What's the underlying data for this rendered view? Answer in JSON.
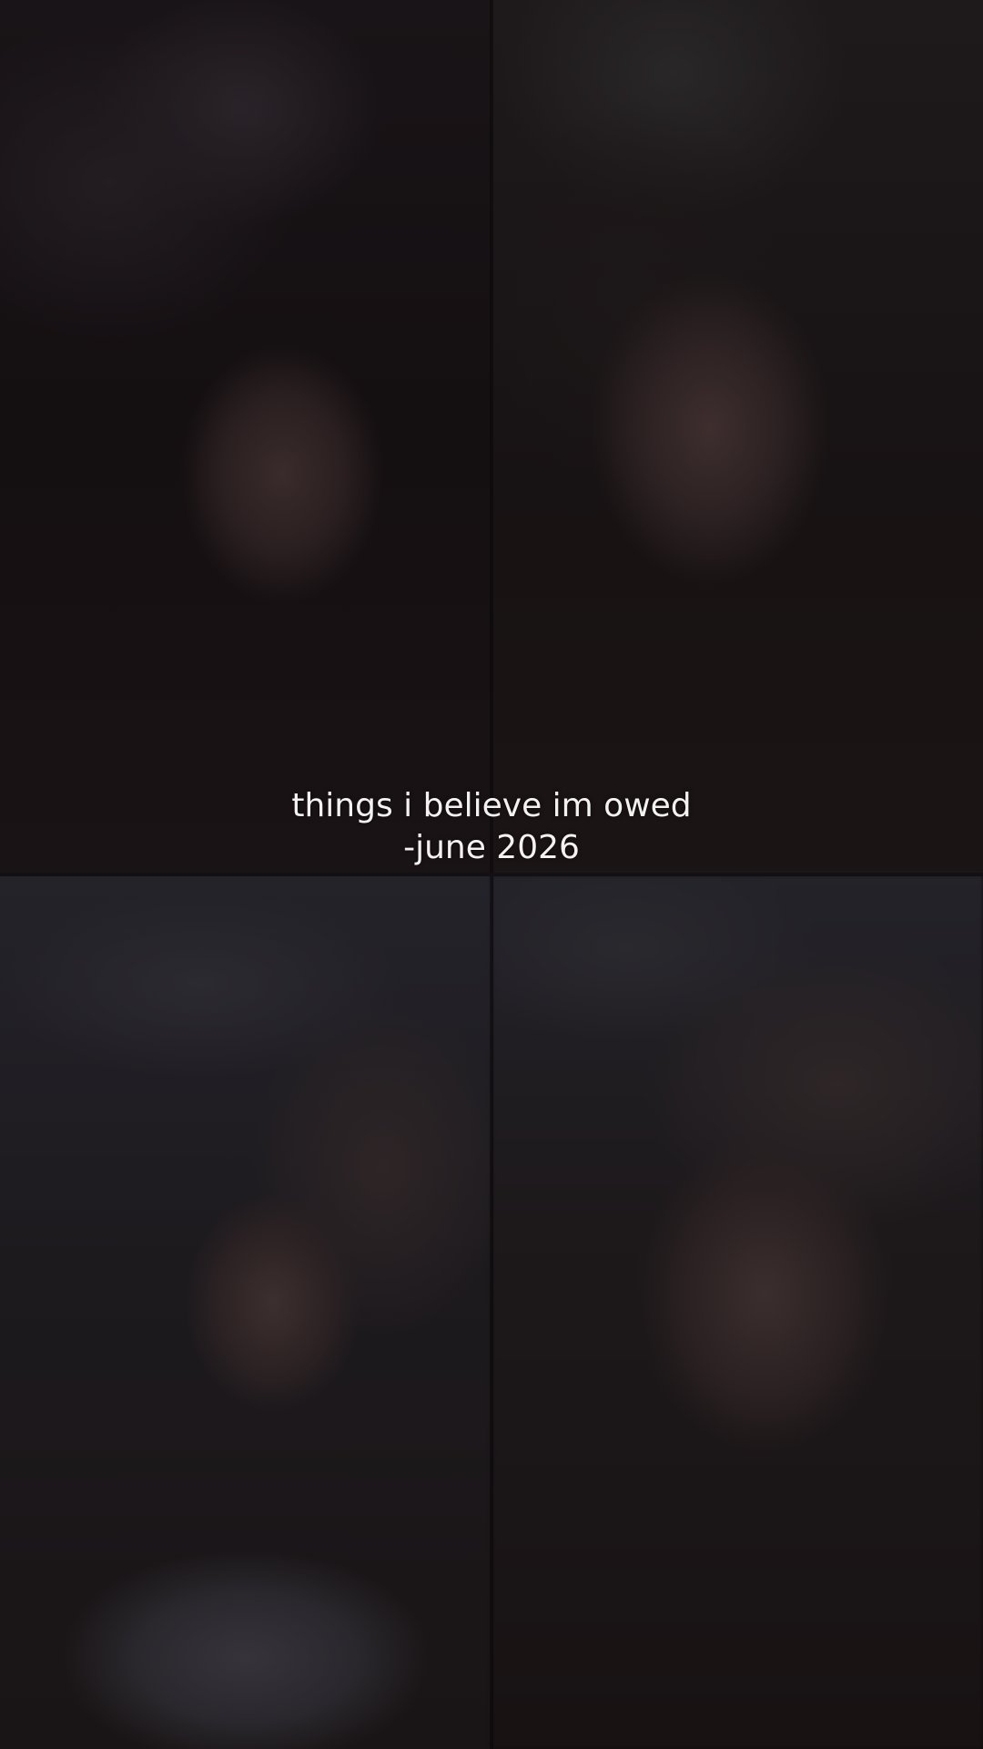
{
  "caption": {
    "line1": "things i believe im owed",
    "line2": "-june 2026"
  },
  "colors": {
    "background": "#0e0b0c",
    "caption_text": "#f4f1f2"
  },
  "panels": [
    {
      "name": "photo-top-left",
      "description_tag": "dark-selfie"
    },
    {
      "name": "photo-top-right",
      "description_tag": "dark-selfie"
    },
    {
      "name": "photo-bottom-left",
      "description_tag": "selfie"
    },
    {
      "name": "photo-bottom-right",
      "description_tag": "blurred-selfie"
    }
  ]
}
